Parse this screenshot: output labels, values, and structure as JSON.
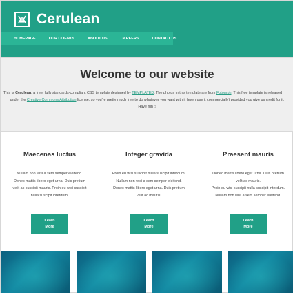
{
  "site": {
    "title": "Cerulean"
  },
  "nav": {
    "items": [
      "HOMEPAGE",
      "OUR CLIENTS",
      "ABOUT US",
      "CAREERS",
      "CONTACT US"
    ]
  },
  "welcome": {
    "heading": "Welcome to our website",
    "line1_prefix": "This is ",
    "line1_name": "Cerulean",
    "line1_middle": ", a free, fully standards-compliant CSS template designed by ",
    "line1_link1": "TEMPLATED",
    "line1_after": ". The photos in this template are from ",
    "line1_link2": "Fotogrph",
    "line1_end": ". This free template is released",
    "line2_prefix": "under the ",
    "line2_link": "Creative Commons Attribution",
    "line2_end": " license, so you're pretty much free to do whatever you want with it (even use it commercially) provided you give us credit for it.",
    "line3": "Have fun :)"
  },
  "columns": [
    {
      "title": "Maecenas luctus",
      "lines": [
        "Nullam non wisi a sem semper eleifend.",
        "Donec mattis libero eget urna. Duis pretium",
        "velit ac suscipit mauris. Proin eu wisi suscipit",
        "nulla suscipit interdum."
      ],
      "button_line1": "Learn",
      "button_line2": "More"
    },
    {
      "title": "Integer gravida",
      "lines": [
        "Proin eu wisi suscipit nulla suscipit interdum.",
        "Nullam non wisi a sem semper eleifend.",
        "Donec mattis libero eget urna. Duis pretium",
        "velit ac mauris."
      ],
      "button_line1": "Learn",
      "button_line2": "More"
    },
    {
      "title": "Praesent mauris",
      "lines": [
        "Donec mattis libero eget urna. Duis pretium",
        "velit ac mauris.",
        "Proin eu wisi suscipit nulla suscipit interdum.",
        "Nullam non wisi a sem semper eleifend."
      ],
      "button_line1": "Learn",
      "button_line2": "More"
    }
  ],
  "colors": {
    "accent": "#21a087",
    "nav_bg": "#2bb596",
    "welcome_bg": "#efefef"
  },
  "icons": {
    "logo": "logo-icon"
  }
}
